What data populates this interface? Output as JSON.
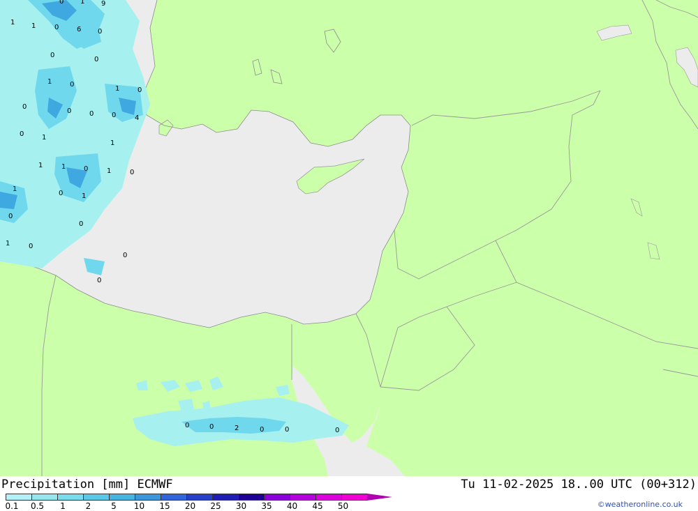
{
  "header": {
    "title_left": "Precipitation [mm] ECMWF",
    "title_right": "Tu 11-02-2025 18..00 UTC (00+312)"
  },
  "colors": {
    "land": "#ccffaa",
    "sea": "#ececec",
    "border": "#999999",
    "precip_light": "#a6f0f0",
    "precip_mid": "#6fd8ec",
    "precip_high": "#3fa8e0"
  },
  "legend": {
    "ticks": [
      "0.1",
      "0.5",
      "1",
      "2",
      "5",
      "10",
      "15",
      "20",
      "25",
      "30",
      "35",
      "40",
      "45",
      "50"
    ],
    "colors": [
      "#b4f0f8",
      "#96e6f0",
      "#78dcec",
      "#5ac8e6",
      "#46b4e0",
      "#3c96dc",
      "#3264dc",
      "#2840c8",
      "#1e1eb4",
      "#1e0096",
      "#8c00dc",
      "#b400dc",
      "#dc00dc",
      "#f000d2"
    ],
    "arrow_color": "#b000b0"
  },
  "credit": "©weatheronline.co.uk",
  "map_labels": [
    {
      "text": "0"
    },
    {
      "text": "1"
    },
    {
      "text": "9"
    },
    {
      "text": "1"
    },
    {
      "text": "1"
    },
    {
      "text": "0"
    },
    {
      "text": "6"
    },
    {
      "text": "0"
    },
    {
      "text": "0"
    },
    {
      "text": "0"
    },
    {
      "text": "1"
    },
    {
      "text": "0"
    },
    {
      "text": "1"
    },
    {
      "text": "0"
    },
    {
      "text": "0"
    },
    {
      "text": "0"
    },
    {
      "text": "0"
    },
    {
      "text": "0"
    },
    {
      "text": "4"
    },
    {
      "text": "0"
    },
    {
      "text": "1"
    },
    {
      "text": "1"
    },
    {
      "text": "1"
    },
    {
      "text": "1"
    },
    {
      "text": "0"
    },
    {
      "text": "1"
    },
    {
      "text": "0"
    },
    {
      "text": "1"
    },
    {
      "text": "0"
    },
    {
      "text": "1"
    },
    {
      "text": "0"
    },
    {
      "text": "0"
    },
    {
      "text": "1"
    },
    {
      "text": "0"
    },
    {
      "text": "0"
    },
    {
      "text": "0"
    },
    {
      "text": "0"
    },
    {
      "text": "0"
    },
    {
      "text": "2"
    },
    {
      "text": "0"
    },
    {
      "text": "0"
    },
    {
      "text": "0"
    }
  ]
}
